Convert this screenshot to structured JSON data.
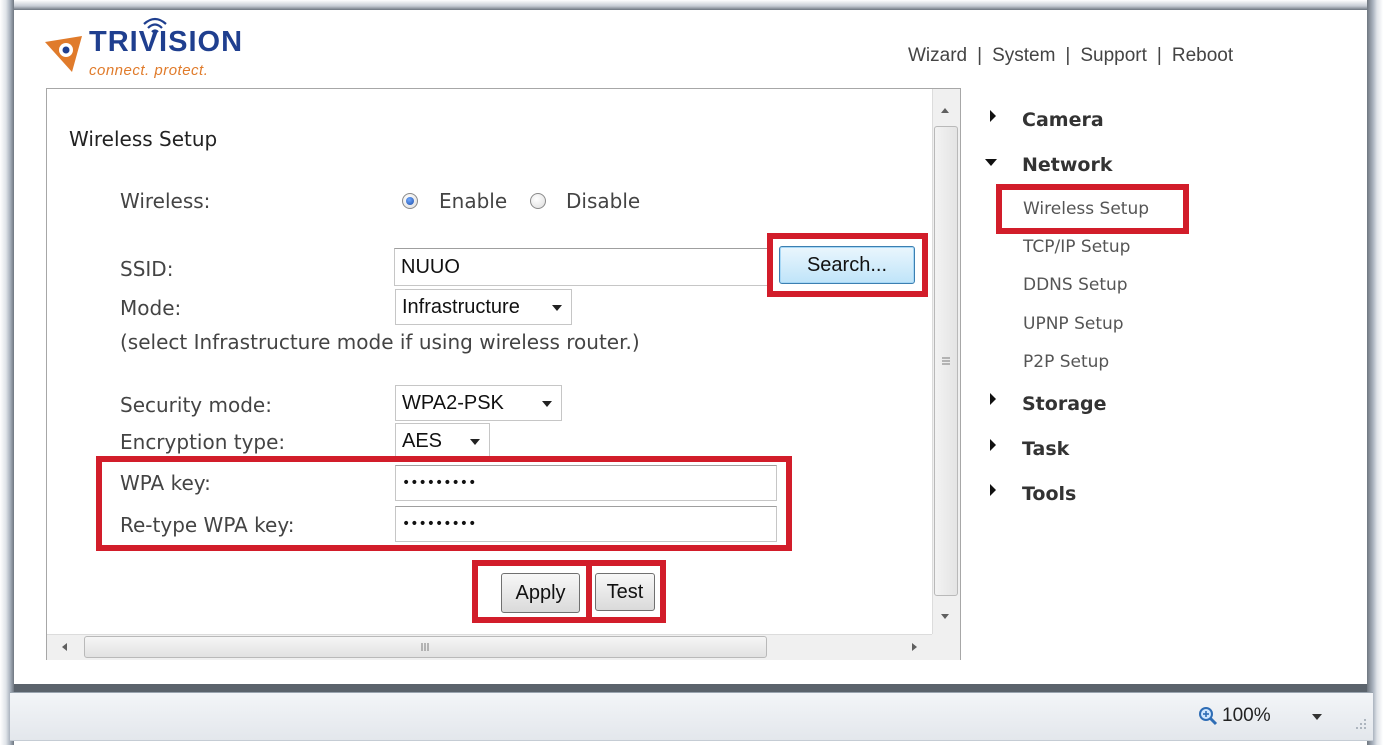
{
  "logo": {
    "word": "TRIVISION",
    "tagline": "connect. protect."
  },
  "topnav": [
    "Wizard",
    "System",
    "Support",
    "Reboot"
  ],
  "form": {
    "title": "Wireless Setup",
    "wireless_label": "Wireless:",
    "enable_label": "Enable",
    "disable_label": "Disable",
    "ssid_label": "SSID:",
    "ssid_value": "NUUO",
    "search_button": "Search...",
    "mode_label": "Mode:",
    "mode_value": "Infrastructure",
    "mode_hint": "(select Infrastructure mode if using wireless router.)",
    "security_label": "Security mode:",
    "security_value": "WPA2-PSK",
    "encryption_label": "Encryption type:",
    "encryption_value": "AES",
    "wpa_label": "WPA key:",
    "wpa_value": "•••••••••",
    "retype_label": "Re-type WPA key:",
    "retype_value": "•••••••••",
    "apply_button": "Apply",
    "test_button": "Test"
  },
  "menu": {
    "camera": "Camera",
    "network": "Network",
    "network_items": [
      "Wireless Setup",
      "TCP/IP Setup",
      "DDNS Setup",
      "UPNP Setup",
      "P2P Setup"
    ],
    "storage": "Storage",
    "task": "Task",
    "tools": "Tools"
  },
  "status": {
    "zoom": "100%"
  },
  "colors": {
    "highlight": "#d21d2a",
    "brand_blue": "#1f3f8f",
    "brand_orange": "#e07b2b"
  }
}
